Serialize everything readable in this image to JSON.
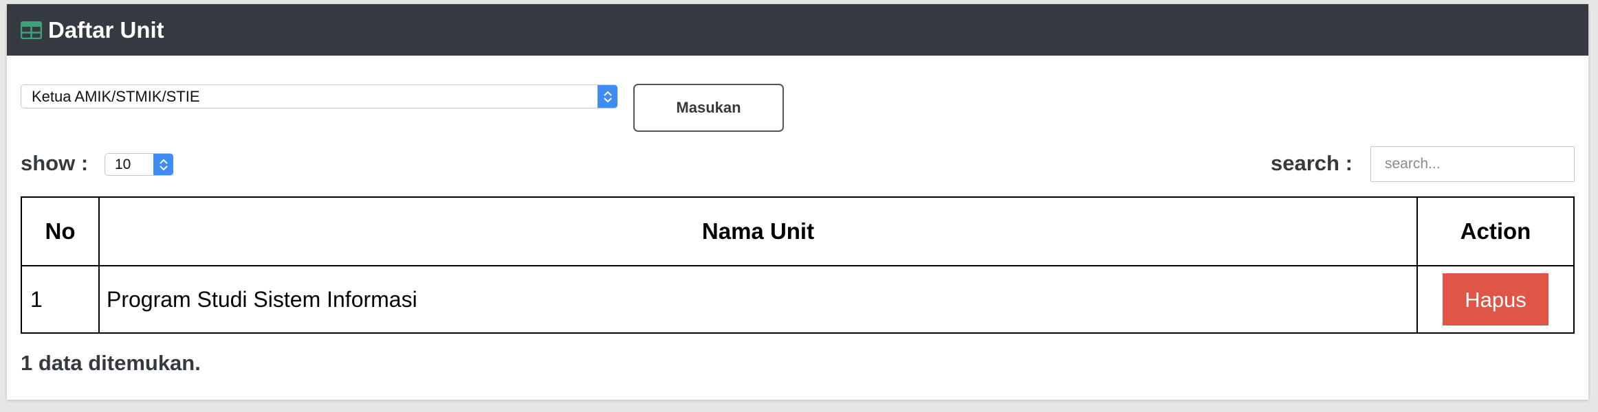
{
  "header": {
    "title": "Daftar Unit",
    "icon": "table-icon",
    "icon_color": "#3fa17d",
    "background": "#343a40"
  },
  "unit_select": {
    "selected": "Ketua AMIK/STMIK/STIE"
  },
  "masukan_button": {
    "label": "Masukan"
  },
  "show": {
    "label": "show :",
    "selected": "10"
  },
  "search": {
    "label": "search :",
    "placeholder": "search..."
  },
  "table": {
    "columns": [
      "No",
      "Nama Unit",
      "Action"
    ],
    "rows": [
      {
        "no": "1",
        "nama_unit": "Program Studi Sistem Informasi",
        "action": "Hapus"
      }
    ]
  },
  "footer": {
    "count_text": "1 data ditemukan."
  },
  "colors": {
    "danger": "#e15546",
    "select_accent": "#3f8cf2"
  }
}
